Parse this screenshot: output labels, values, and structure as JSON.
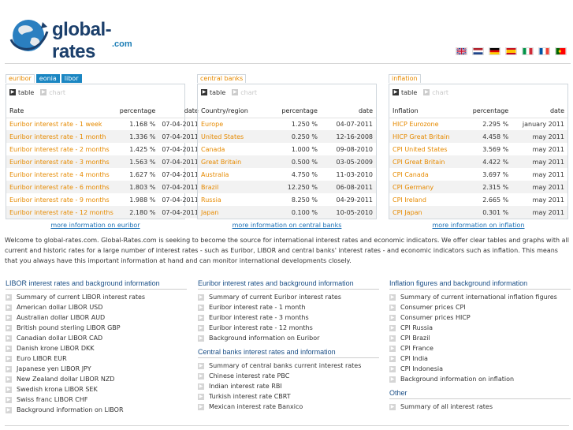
{
  "header": {
    "logo_name": "global-rates",
    "logo_suffix": ".com",
    "flags": [
      "uk-flag",
      "netherlands-flag",
      "germany-flag",
      "spain-flag",
      "italy-flag",
      "france-flag",
      "portugal-flag"
    ]
  },
  "colors": {
    "accent_orange": "#e68a00",
    "tab_blue": "#1a86c2",
    "link_blue": "#1a6fb5",
    "heading_blue": "#1b4f86"
  },
  "panels": {
    "euribor": {
      "tabs": [
        "euribor",
        "eonia",
        "libor"
      ],
      "view_table": "table",
      "view_chart": "chart",
      "headers": [
        "Rate",
        "percentage",
        "date"
      ],
      "rows": [
        [
          "Euribor interest rate - 1 week",
          "1.168 %",
          "07-04-2011"
        ],
        [
          "Euribor interest rate - 1 month",
          "1.336 %",
          "07-04-2011"
        ],
        [
          "Euribor interest rate - 2 months",
          "1.425 %",
          "07-04-2011"
        ],
        [
          "Euribor interest rate - 3 months",
          "1.563 %",
          "07-04-2011"
        ],
        [
          "Euribor interest rate - 4 months",
          "1.627 %",
          "07-04-2011"
        ],
        [
          "Euribor interest rate - 6 months",
          "1.803 %",
          "07-04-2011"
        ],
        [
          "Euribor interest rate - 9 months",
          "1.988 %",
          "07-04-2011"
        ],
        [
          "Euribor interest rate - 12 months",
          "2.180 %",
          "07-04-2011"
        ]
      ],
      "more": "more information on euribor"
    },
    "central": {
      "tabs": [
        "central banks"
      ],
      "view_table": "table",
      "view_chart": "chart",
      "headers": [
        "Country/region",
        "percentage",
        "date"
      ],
      "rows": [
        [
          "Europe",
          "1.250 %",
          "04-07-2011"
        ],
        [
          "United States",
          "0.250 %",
          "12-16-2008"
        ],
        [
          "Canada",
          "1.000 %",
          "09-08-2010"
        ],
        [
          "Great Britain",
          "0.500 %",
          "03-05-2009"
        ],
        [
          "Australia",
          "4.750 %",
          "11-03-2010"
        ],
        [
          "Brazil",
          "12.250 %",
          "06-08-2011"
        ],
        [
          "Russia",
          "8.250 %",
          "04-29-2011"
        ],
        [
          "Japan",
          "0.100 %",
          "10-05-2010"
        ]
      ],
      "more": "more information on central banks"
    },
    "inflation": {
      "tabs": [
        "inflation"
      ],
      "view_table": "table",
      "view_chart": "chart",
      "headers": [
        "Inflation",
        "percentage",
        "date"
      ],
      "rows": [
        [
          "HICP Eurozone",
          "2.295 %",
          "january 2011"
        ],
        [
          "HICP Great Britain",
          "4.458 %",
          "may 2011"
        ],
        [
          "CPI United States",
          "3.569 %",
          "may 2011"
        ],
        [
          "CPI Great Britain",
          "4.422 %",
          "may 2011"
        ],
        [
          "CPI Canada",
          "3.697 %",
          "may 2011"
        ],
        [
          "CPI Germany",
          "2.315 %",
          "may 2011"
        ],
        [
          "CPI Ireland",
          "2.665 %",
          "may 2011"
        ],
        [
          "CPI Japan",
          "0.301 %",
          "may 2011"
        ]
      ],
      "more": "more information on inflation"
    }
  },
  "welcome": "Welcome to global-rates.com. Global-Rates.com is seeking to become the source for international interest rates and economic indicators. We offer clear tables and graphs with all current and historic rates for a large number of interest rates - such as Euribor, LIBOR and central banks' interest rates - and economic indicators such as inflation. This means that you always have this important information at hand and can monitor international developments closely.",
  "columns": {
    "libor": {
      "title": "LIBOR interest rates and background information",
      "items": [
        "Summary of current LIBOR interest rates",
        "American dollar LIBOR USD",
        "Australian dollar LIBOR AUD",
        "British pound sterling LIBOR GBP",
        "Canadian dollar LIBOR CAD",
        "Danish krone LIBOR DKK",
        "Euro LIBOR EUR",
        "Japanese yen LIBOR JPY",
        "New Zealand dollar LIBOR NZD",
        "Swedish krona LIBOR SEK",
        "Swiss franc LIBOR CHF",
        "Background information on LIBOR"
      ]
    },
    "euribor": {
      "title": "Euribor interest rates and background information",
      "items": [
        "Summary of current Euribor interest rates",
        "Euribor interest rate - 1 month",
        "Euribor interest rate - 3 months",
        "Euribor interest rate - 12 months",
        "Background information on Euribor"
      ],
      "title2": "Central banks interest rates and information",
      "items2": [
        "Summary of central banks current interest rates",
        "Chinese interest rate PBC",
        "Indian interest rate RBI",
        "Turkish interest rate CBRT",
        "Mexican interest rate Banxico"
      ]
    },
    "inflation": {
      "title": "Inflation figures and background information",
      "items": [
        "Summary of current international inflation figures",
        "Consumer prices CPI",
        "Consumer prices HICP",
        "CPI Russia",
        "CPI Brazil",
        "CPI France",
        "CPI India",
        "CPI Indonesia",
        "Background information on inflation"
      ],
      "title2": "Other",
      "items2": [
        "Summary of all interest rates"
      ]
    }
  }
}
